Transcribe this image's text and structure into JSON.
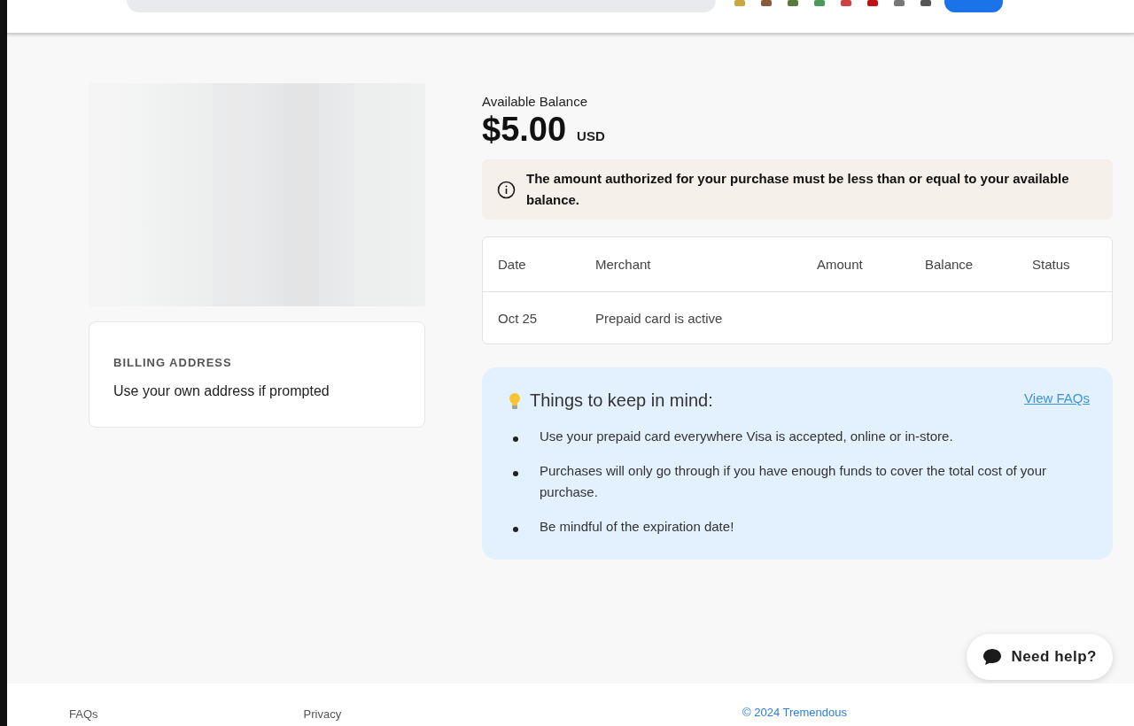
{
  "balance": {
    "label": "Available Balance",
    "amount": "$5.00",
    "currency": "USD"
  },
  "notice": {
    "text": "The amount authorized for your purchase must be less than or equal to your available balance."
  },
  "billing": {
    "heading": "BILLING ADDRESS",
    "text": "Use your own address if prompted"
  },
  "table": {
    "columns": [
      "Date",
      "Merchant",
      "Amount",
      "Balance",
      "Status"
    ],
    "rows": [
      [
        "Oct 25",
        "Prepaid card is active",
        "",
        "",
        ""
      ]
    ]
  },
  "tips": {
    "title": "Things to keep in mind:",
    "link": "View FAQs",
    "items": [
      "Use your prepaid card everywhere Visa is accepted, online or in-store.",
      "Purchases will only go through if you have enough funds to cover the total cost of your purchase.",
      "Be mindful of the expiration date!"
    ]
  },
  "help_button": {
    "label": "Need help?"
  },
  "footer": {
    "links": [
      "FAQs",
      "Privacy"
    ],
    "copyright": "© 2024 Tremendous"
  }
}
